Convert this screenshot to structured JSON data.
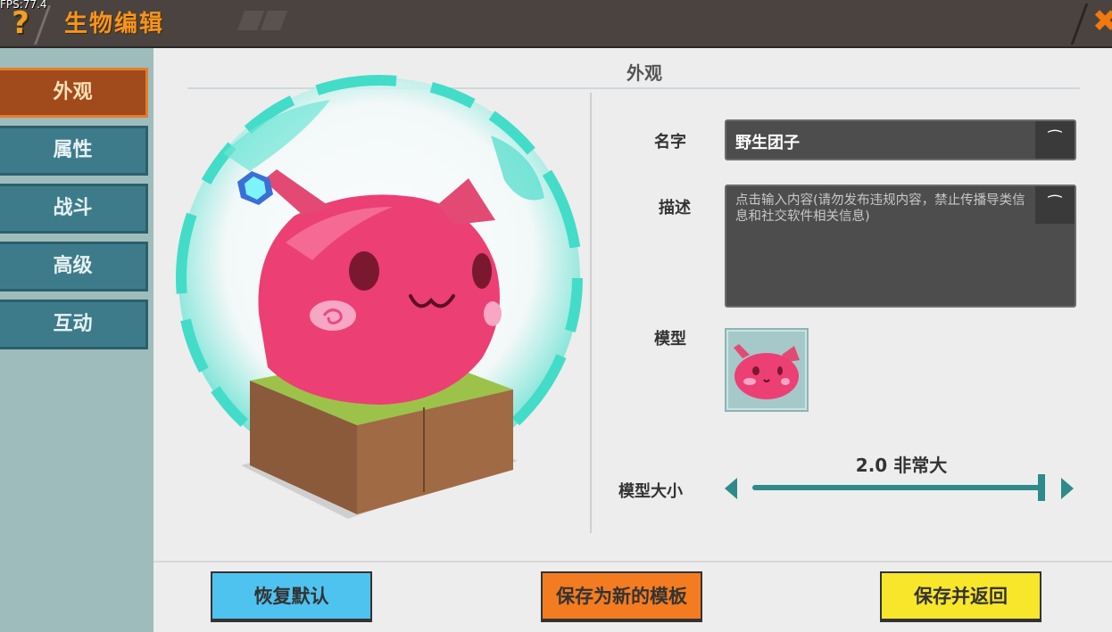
{
  "header": {
    "fps": "FPS:77.4",
    "help_glyph": "?",
    "title": "生物编辑",
    "close_glyph": "✖"
  },
  "sidebar": {
    "tabs": [
      {
        "label": "外观",
        "active": true
      },
      {
        "label": "属性",
        "active": false
      },
      {
        "label": "战斗",
        "active": false
      },
      {
        "label": "高级",
        "active": false
      },
      {
        "label": "互动",
        "active": false
      }
    ]
  },
  "main": {
    "section_title": "外观",
    "preview_icon": "pink-slime-on-grass-block",
    "name": {
      "label": "名字",
      "value": "野生团子",
      "icon": "eye-closed-icon"
    },
    "description": {
      "label": "描述",
      "placeholder": "点击输入内容(请勿发布违规内容，禁止传播导类信息和社交软件相关信息)",
      "icon": "eye-closed-icon"
    },
    "model": {
      "label": "模型",
      "thumbnail_icon": "pink-slime-icon"
    },
    "model_size": {
      "label": "模型大小",
      "value_text": "2.0 非常大",
      "slider_fraction": 1.0
    }
  },
  "buttons": {
    "reset": "恢复默认",
    "save_template": "保存为新的模板",
    "save_return": "保存并返回"
  },
  "colors": {
    "accent_orange": "#f7941d",
    "teal": "#2f8a8a",
    "tab_teal": "#3e7b8a",
    "tab_active": "#a14a1c",
    "btn_blue": "#4fc3f0",
    "btn_orange": "#f47c20",
    "btn_yellow": "#f7e62a"
  }
}
